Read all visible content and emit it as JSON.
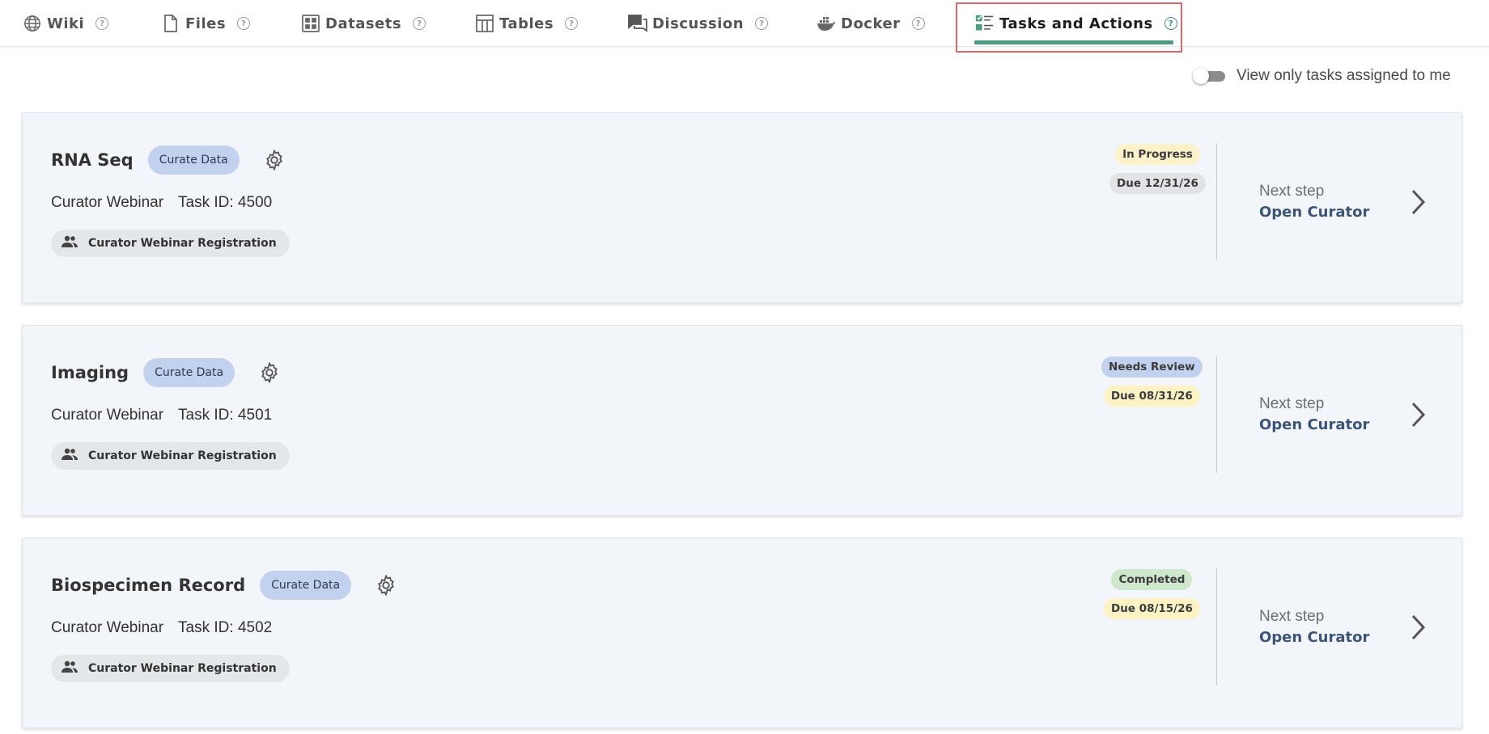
{
  "tabs": [
    {
      "label": "Wiki",
      "icon": "globe-icon",
      "active": false
    },
    {
      "label": "Files",
      "icon": "file-icon",
      "active": false
    },
    {
      "label": "Datasets",
      "icon": "grid-icon",
      "active": false
    },
    {
      "label": "Tables",
      "icon": "table-icon",
      "active": false
    },
    {
      "label": "Discussion",
      "icon": "chat-icon",
      "active": false
    },
    {
      "label": "Docker",
      "icon": "docker-icon",
      "active": false
    },
    {
      "label": "Tasks and Actions",
      "icon": "checklist-icon",
      "active": true
    }
  ],
  "help_glyph": "?",
  "toggle": {
    "label": "View only tasks assigned to me",
    "on": false
  },
  "tasks": [
    {
      "title": "RNA Seq",
      "type": "Curate Data",
      "project": "Curator Webinar",
      "task_id": "Task ID: 4500",
      "group": "Curator Webinar Registration",
      "status": "In Progress",
      "due": "Due 12/31/26",
      "next_label": "Next step",
      "next_action": "Open Curator"
    },
    {
      "title": "Imaging",
      "type": "Curate Data",
      "project": "Curator Webinar",
      "task_id": "Task ID: 4501",
      "group": "Curator Webinar Registration",
      "status": "Needs Review",
      "due": "Due 08/31/26",
      "next_label": "Next step",
      "next_action": "Open Curator"
    },
    {
      "title": "Biospecimen Record",
      "type": "Curate Data",
      "project": "Curator Webinar",
      "task_id": "Task ID: 4502",
      "group": "Curator Webinar Registration",
      "status": "Completed",
      "due": "Due 08/15/26",
      "next_label": "Next step",
      "next_action": "Open Curator"
    }
  ],
  "colors": {
    "accent": "#4f9b82",
    "highlight_border": "#e0666a",
    "status_in_progress": "#fbf2c9",
    "status_needs_review": "#c2d2ee",
    "status_completed": "#cfe7cd",
    "due_neutral": "#e1e3e6",
    "due_upcoming": "#fbf3c4"
  }
}
